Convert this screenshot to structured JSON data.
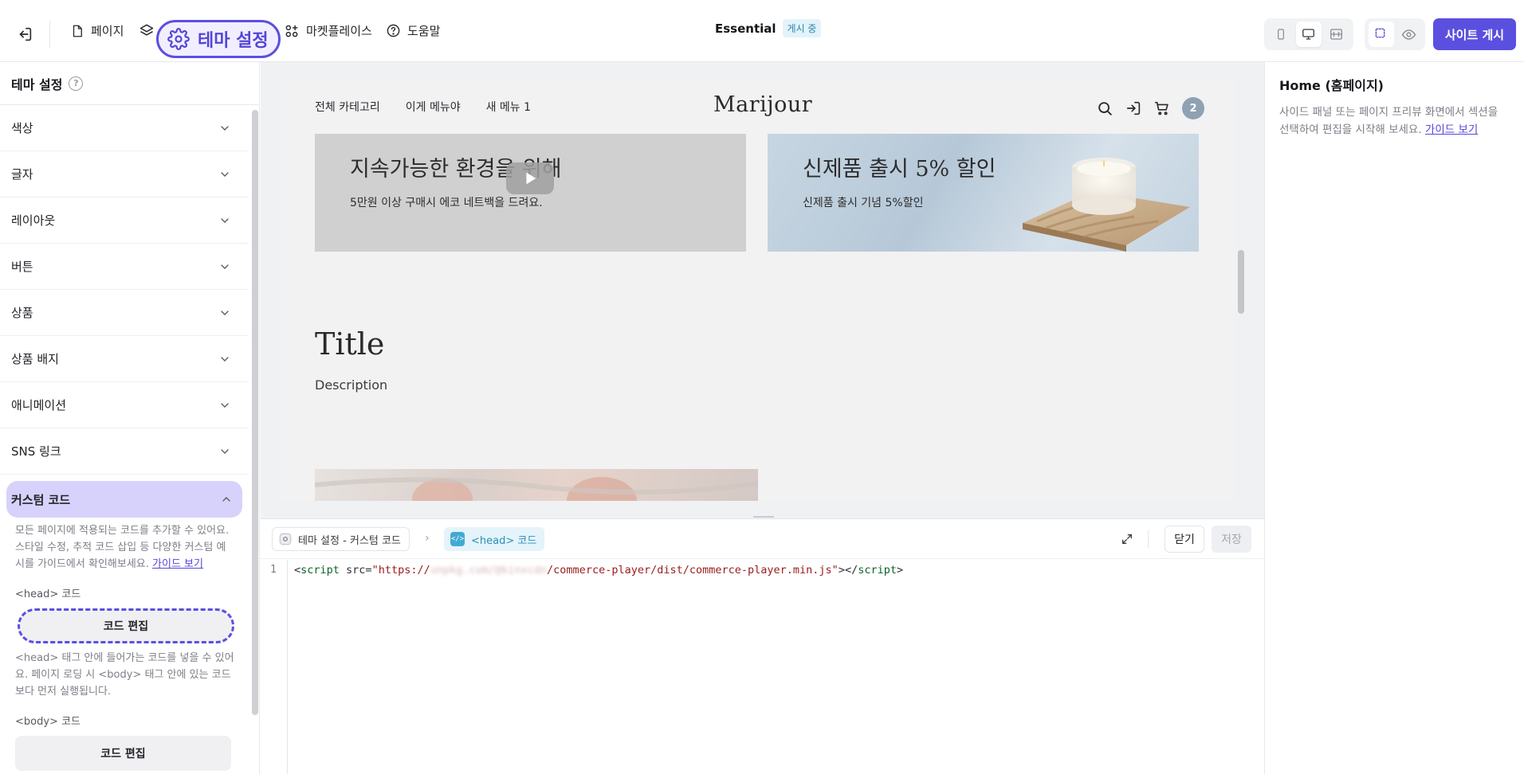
{
  "topbar": {
    "nav": {
      "pages": "페이지",
      "theme": "테마 설정",
      "marketplace": "마켓플레이스",
      "help": "도움말"
    },
    "site_name": "Essential",
    "status": "게시 중",
    "publish": "사이트 게시"
  },
  "sidebar": {
    "title": "테마 설정",
    "items": [
      {
        "label": "색상"
      },
      {
        "label": "글자"
      },
      {
        "label": "레이아웃"
      },
      {
        "label": "버튼"
      },
      {
        "label": "상품"
      },
      {
        "label": "상품 배지"
      },
      {
        "label": "애니메이션"
      },
      {
        "label": "SNS 링크"
      }
    ],
    "open_item": {
      "label": "커스텀 코드",
      "description": "모든 페이지에 적용되는 코드를 추가할 수 있어요. 스타일 수정, 추적 코드 삽입 등 다양한 커스텀 예시를 가이드에서 확인해보세요.",
      "guide_link": "가이드 보기",
      "head_label": "<head> 코드",
      "head_button": "코드 편집",
      "head_description": "<head> 태그 안에 들어가는 코드를 넣을 수 있어요. 페이지 로딩 시 <body> 태그 안에 있는 코드보다 먼저 실행됩니다.",
      "body_label": "<body> 코드",
      "body_button": "코드 편집"
    }
  },
  "preview": {
    "nav_links": [
      "전체 카테고리",
      "이게 메뉴야",
      "새 메뉴 1"
    ],
    "logo": "Marijour",
    "cart_count": "2",
    "banners": [
      {
        "title": "지속가능한 환경을 위해",
        "subtitle": "5만원 이상 구매시 에코 네트백을 드려요."
      },
      {
        "title": "신제품 출시 5% 할인",
        "subtitle": "신제품 출시 기념 5%할인"
      }
    ],
    "section_title": "Title",
    "section_desc": "Description"
  },
  "editor": {
    "crumb1": "테마 설정 - 커스텀 코드",
    "crumb2": "<head> 코드",
    "close": "닫기",
    "save": "저장",
    "line_number": "1",
    "code": {
      "open_bracket": "<",
      "tag": "script",
      "attr": " src=",
      "q1": "\"",
      "url_scheme": "https://",
      "url_blurred": "unpkg.com/@kinxcdn",
      "url_path": "/commerce-player/dist/commerce-player.min.js",
      "q2": "\"",
      "mid": "></",
      "tag_close": "script",
      "end": ">"
    }
  },
  "right_panel": {
    "title": "Home (홈페이지)",
    "description": "사이드 패널 또는 페이지 프리뷰 화면에서 섹션을 선택하여 편집을 시작해 보세요.",
    "guide_link": "가이드 보기"
  },
  "colors": {
    "accent": "#5b4fe0",
    "accent_light": "#d7d2fb",
    "status_bg": "#e3f3fa",
    "cart_badge": "#8fa1b3"
  }
}
